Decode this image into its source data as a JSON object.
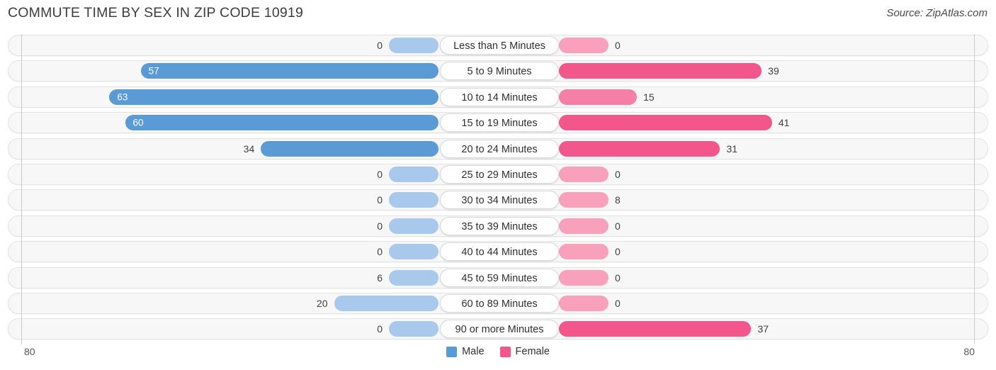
{
  "header": {
    "title": "COMMUTE TIME BY SEX IN ZIP CODE 10919",
    "source": "Source: ZipAtlas.com"
  },
  "axis": {
    "left_end": "80",
    "right_end": "80"
  },
  "legend": {
    "items": [
      {
        "label": "Male",
        "color": "#5b9bd5"
      },
      {
        "label": "Female",
        "color": "#f2568a"
      }
    ]
  },
  "colors": {
    "male_strong": "#5b9bd5",
    "male_light": "#a8c8ec",
    "female_strong": "#f2568a",
    "female_mid": "#f57fa6",
    "female_light": "#f9a0bd",
    "track": "#f7f7f7",
    "track_border": "#e3e3e3",
    "gridline": "#c9c9c9"
  },
  "chart_data": {
    "type": "bar",
    "orientation": "horizontal-diverging",
    "title": "COMMUTE TIME BY SEX IN ZIP CODE 10919",
    "xlabel": "",
    "ylabel": "",
    "xlim_left": [
      80,
      0
    ],
    "xlim_right": [
      0,
      80
    ],
    "grid": true,
    "legend_position": "bottom-center",
    "categories": [
      "Less than 5 Minutes",
      "5 to 9 Minutes",
      "10 to 14 Minutes",
      "15 to 19 Minutes",
      "20 to 24 Minutes",
      "25 to 29 Minutes",
      "30 to 34 Minutes",
      "35 to 39 Minutes",
      "40 to 44 Minutes",
      "45 to 59 Minutes",
      "60 to 89 Minutes",
      "90 or more Minutes"
    ],
    "series": [
      {
        "name": "Male",
        "values": [
          0,
          57,
          63,
          60,
          34,
          0,
          0,
          0,
          0,
          6,
          20,
          0
        ]
      },
      {
        "name": "Female",
        "values": [
          0,
          39,
          15,
          41,
          31,
          0,
          8,
          0,
          0,
          0,
          0,
          37
        ]
      }
    ]
  },
  "rows": [
    {
      "label": "Less than 5 Minutes",
      "male": "0",
      "female": "0"
    },
    {
      "label": "5 to 9 Minutes",
      "male": "57",
      "female": "39"
    },
    {
      "label": "10 to 14 Minutes",
      "male": "63",
      "female": "15"
    },
    {
      "label": "15 to 19 Minutes",
      "male": "60",
      "female": "41"
    },
    {
      "label": "20 to 24 Minutes",
      "male": "34",
      "female": "31"
    },
    {
      "label": "25 to 29 Minutes",
      "male": "0",
      "female": "0"
    },
    {
      "label": "30 to 34 Minutes",
      "male": "0",
      "female": "8"
    },
    {
      "label": "35 to 39 Minutes",
      "male": "0",
      "female": "0"
    },
    {
      "label": "40 to 44 Minutes",
      "male": "0",
      "female": "0"
    },
    {
      "label": "45 to 59 Minutes",
      "male": "6",
      "female": "0"
    },
    {
      "label": "60 to 89 Minutes",
      "male": "20",
      "female": "0"
    },
    {
      "label": "90 or more Minutes",
      "male": "0",
      "female": "37"
    }
  ]
}
